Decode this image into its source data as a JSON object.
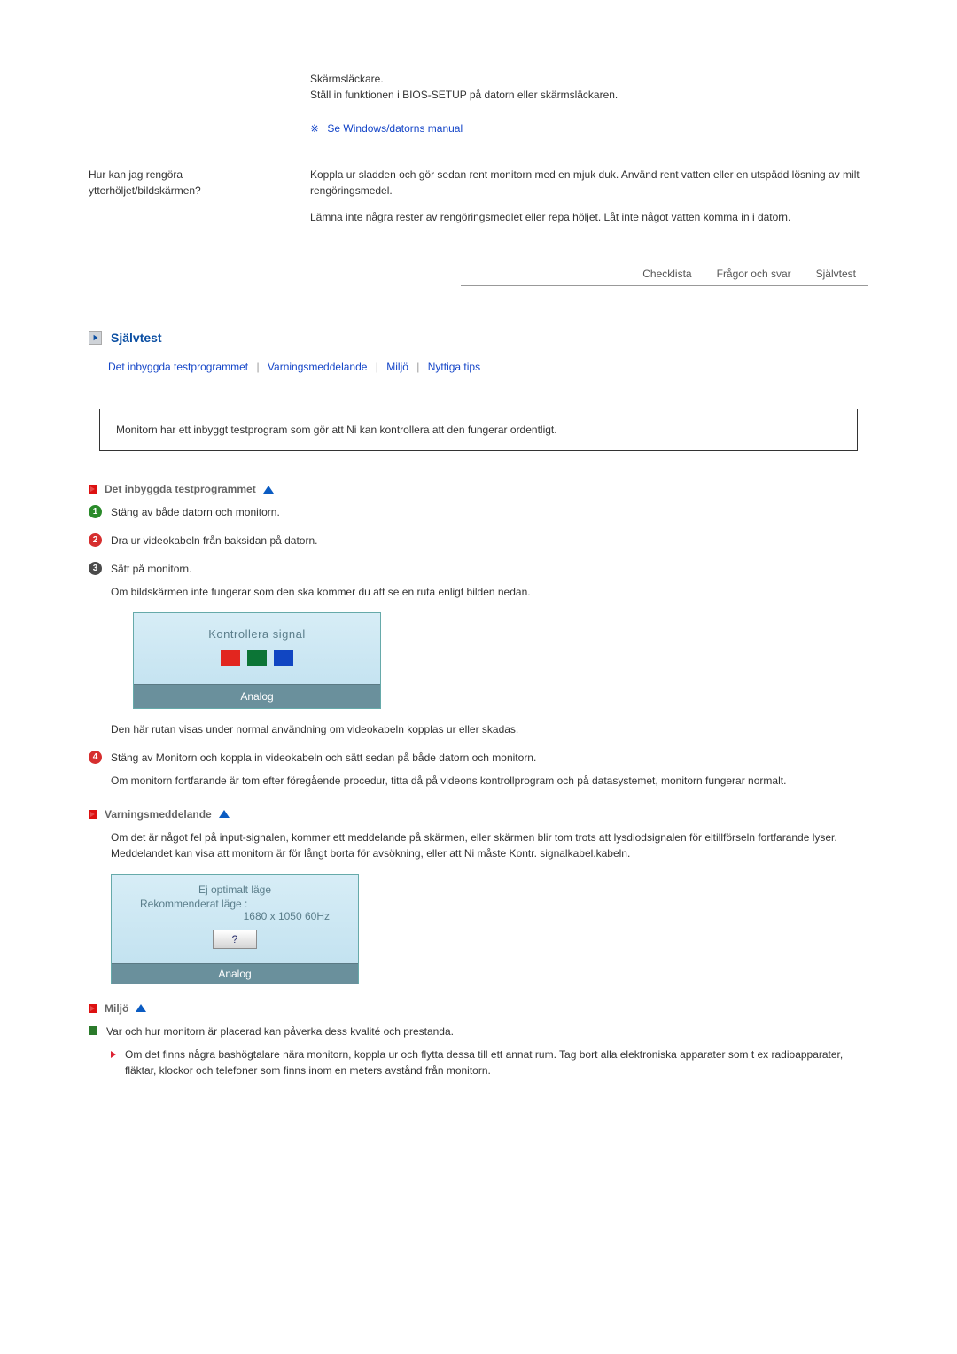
{
  "top_block": {
    "line1": "Skärmsläckare.",
    "line2": "Ställ in funktionen i BIOS-SETUP på datorn eller skärmsläckaren.",
    "manual_link": "Se Windows/datorns manual"
  },
  "qa": {
    "question": "Hur kan jag rengöra ytterhöljet/bildskärmen?",
    "answer1": "Koppla ur sladden och gör sedan rent monitorn med en mjuk duk. Använd rent vatten eller en utspädd lösning av milt rengöringsmedel.",
    "answer2": "Lämna inte några rester av rengöringsmedlet eller repa höljet. Låt inte något vatten komma in i datorn."
  },
  "tabs": {
    "t1": "Checklista",
    "t2": "Frågor och svar",
    "t3": "Självtest"
  },
  "section": {
    "title": "Självtest"
  },
  "sublinks": {
    "l1": "Det inbyggda testprogrammet",
    "l2": "Varningsmeddelande",
    "l3": "Miljö",
    "l4": "Nyttiga tips"
  },
  "intro": "Monitorn har ett inbyggt testprogram som gör att Ni kan kontrollera att den fungerar ordentligt.",
  "sub1": {
    "title": "Det inbyggda testprogrammet"
  },
  "steps": {
    "s1": "Stäng av både datorn och monitorn.",
    "s2": "Dra ur videokabeln från baksidan på datorn.",
    "s3": "Sätt på monitorn.",
    "s3b": "Om bildskärmen inte fungerar som den ska kommer du att se en ruta enligt bilden nedan.",
    "s3c": "Den här rutan visas under normal användning om videokabeln kopplas ur eller skadas.",
    "s4": "Stäng av Monitorn och koppla in videokabeln och sätt sedan på både datorn och monitorn.",
    "s4b": "Om monitorn fortfarande är tom efter föregående procedur, titta då på videons kontrollprogram och på datasystemet, monitorn fungerar normalt."
  },
  "monitor1": {
    "title": "Kontrollera signal",
    "footer": "Analog"
  },
  "sub2": {
    "title": "Varningsmeddelande",
    "body": "Om det är något fel på input-signalen, kommer ett meddelande på skärmen, eller skärmen blir tom trots att lysdiodsignalen för eltillförseln fortfarande lyser. Meddelandet kan visa att monitorn är för långt borta för avsökning, eller att Ni måste Kontr. signalkabel.kabeln."
  },
  "monitor2": {
    "l1": "Ej optimalt läge",
    "l2": "Rekommenderat läge :",
    "l3": "1680 x 1050  60Hz",
    "btn": "?",
    "footer": "Analog"
  },
  "sub3": {
    "title": "Miljö",
    "b1": "Var och hur monitorn är placerad kan påverka dess kvalité och prestanda.",
    "b2": "Om det finns några bashögtalare nära monitorn, koppla ur och flytta dessa till ett annat rum. Tag bort alla elektroniska apparater som t ex radioapparater, fläktar, klockor och telefoner som finns inom en meters avstånd från monitorn."
  }
}
